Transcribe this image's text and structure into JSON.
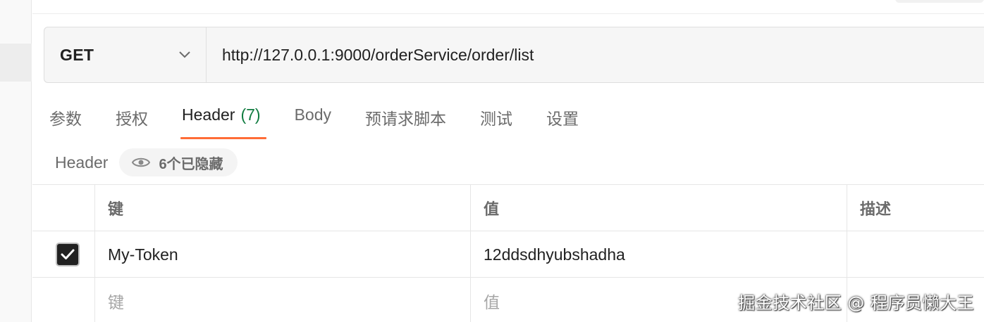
{
  "request": {
    "method": "GET",
    "url": "http://127.0.0.1:9000/orderService/order/list"
  },
  "tabs": [
    {
      "label": "参数"
    },
    {
      "label": "授权"
    },
    {
      "label": "Header",
      "count": "(7)"
    },
    {
      "label": "Body"
    },
    {
      "label": "预请求脚本"
    },
    {
      "label": "测试"
    },
    {
      "label": "设置"
    }
  ],
  "active_tab": "Header",
  "header_section": {
    "label": "Header",
    "hidden_chip": "6个已隐藏"
  },
  "table": {
    "columns": {
      "key": "键",
      "value": "值",
      "description": "描述"
    },
    "rows": [
      {
        "checked": true,
        "key": "My-Token",
        "value": "12ddsdhyubshadha",
        "description": ""
      }
    ],
    "empty_row": {
      "key_placeholder": "键",
      "value_placeholder": "值"
    }
  },
  "watermark": "掘金技术社区 @ 程序员懒大王",
  "icons": {
    "method_dropdown": "chevron-down-icon",
    "hidden_indicator": "eye-icon",
    "row_checkbox": "check-icon"
  },
  "colors": {
    "active_tab_underline": "#ff6c37",
    "tab_count": "#0f7b3f",
    "checkbox_fill": "#212121"
  }
}
